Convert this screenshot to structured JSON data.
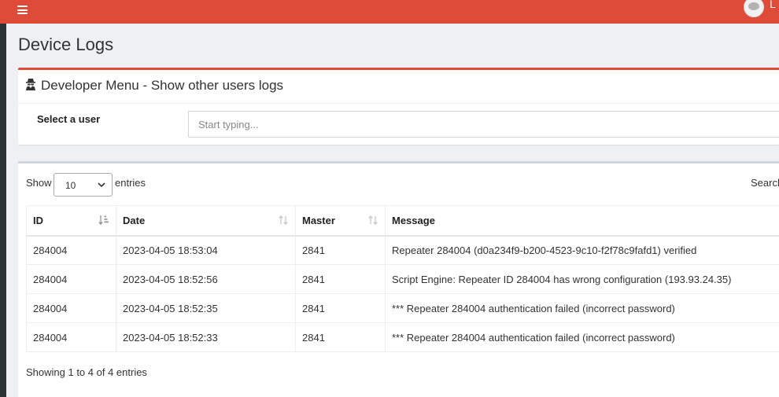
{
  "topbar": {
    "menu_icon": "hamburger-icon",
    "user_initial": "L",
    "brand_color": "#de4b39"
  },
  "page": {
    "title": "Device Logs"
  },
  "developer_panel": {
    "icon": "spy-icon",
    "title": "Developer Menu - Show other users logs",
    "select_label": "Select a user",
    "input_placeholder": "Start typing...",
    "input_value": ""
  },
  "table_controls": {
    "show_label": "Show",
    "entries_value": "10",
    "entries_label": "entries",
    "search_label": "Search"
  },
  "table": {
    "columns": [
      "ID",
      "Date",
      "Master",
      "Message"
    ],
    "rows": [
      [
        "284004",
        "2023-04-05 18:53:04",
        "2841",
        "Repeater 284004 (d0a234f9-b200-4523-9c10-f2f78c9fafd1) verified"
      ],
      [
        "284004",
        "2023-04-05 18:52:56",
        "2841",
        "Script Engine: Repeater ID 284004 has wrong configuration (193.93.24.35)"
      ],
      [
        "284004",
        "2023-04-05 18:52:35",
        "2841",
        "*** Repeater 284004 authentication failed (incorrect password)"
      ],
      [
        "284004",
        "2023-04-05 18:52:33",
        "2841",
        "*** Repeater 284004 authentication failed (incorrect password)"
      ]
    ],
    "info": "Showing 1 to 4 of 4 entries"
  }
}
